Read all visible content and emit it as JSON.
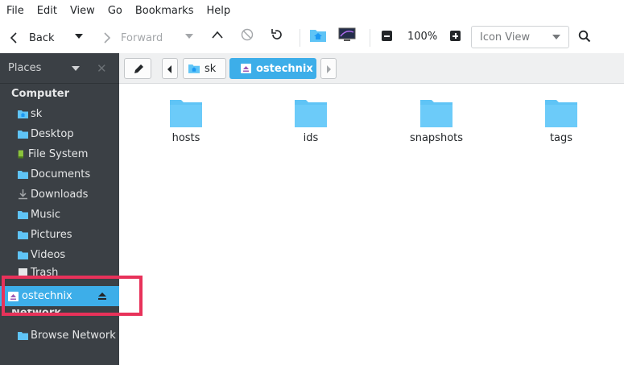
{
  "menubar": {
    "items": [
      "File",
      "Edit",
      "View",
      "Go",
      "Bookmarks",
      "Help"
    ]
  },
  "toolbar": {
    "back_label": "Back",
    "forward_label": "Forward",
    "zoom": "100%",
    "view_mode": "Icon View"
  },
  "sidebar": {
    "header": "Places",
    "section_computer": "Computer",
    "section_network": "Network",
    "items": [
      {
        "label": "sk",
        "icon": "home-folder-icon"
      },
      {
        "label": "Desktop",
        "icon": "folder-icon"
      },
      {
        "label": "File System",
        "icon": "drive-icon"
      },
      {
        "label": "Documents",
        "icon": "folder-icon"
      },
      {
        "label": "Downloads",
        "icon": "download-icon"
      },
      {
        "label": "Music",
        "icon": "folder-icon"
      },
      {
        "label": "Pictures",
        "icon": "folder-icon"
      },
      {
        "label": "Videos",
        "icon": "folder-icon"
      },
      {
        "label": "Trash",
        "icon": "trash-icon"
      },
      {
        "label": "ostechnix",
        "icon": "removable-drive-icon",
        "selected": true
      }
    ],
    "network_items": [
      {
        "label": "Browse Network",
        "icon": "network-folder-icon"
      }
    ]
  },
  "location": {
    "crumbs": [
      "sk",
      "ostechnix"
    ]
  },
  "files": [
    {
      "name": "hosts",
      "icon": "folder-icon"
    },
    {
      "name": "ids",
      "icon": "folder-icon"
    },
    {
      "name": "snapshots",
      "icon": "folder-icon"
    },
    {
      "name": "tags",
      "icon": "folder-icon"
    }
  ],
  "colors": {
    "accent": "#3daee9",
    "sidebar_bg": "#3b4045",
    "highlight": "#e8325a",
    "folder": "#5fc4f6"
  }
}
